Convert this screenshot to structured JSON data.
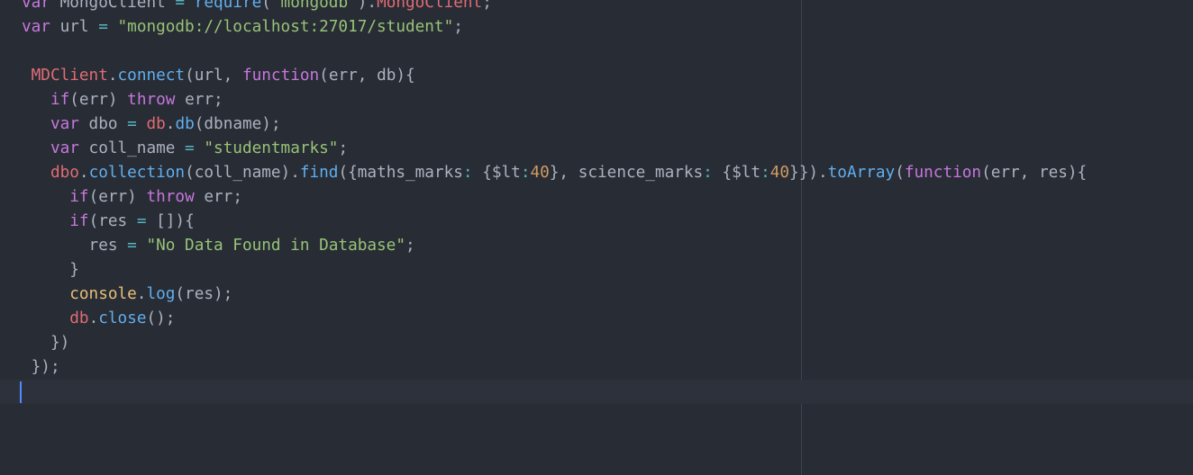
{
  "editor": {
    "language": "javascript",
    "theme_colors": {
      "background": "#282c34",
      "keyword": "#c678dd",
      "string": "#98c379",
      "number": "#d19a66",
      "function": "#61afef",
      "variable": "#e06c75",
      "support": "#e5c07b",
      "plain": "#abb2bf",
      "cursor": "#528bff"
    },
    "lines": [
      [
        {
          "t": "var",
          "c": "kw"
        },
        {
          "t": " MongoClient ",
          "c": "pl"
        },
        {
          "t": "=",
          "c": "op"
        },
        {
          "t": " ",
          "c": "pl"
        },
        {
          "t": "require",
          "c": "fn"
        },
        {
          "t": "(",
          "c": "pl"
        },
        {
          "t": "'mongodb'",
          "c": "str"
        },
        {
          "t": ").",
          "c": "pl"
        },
        {
          "t": "MongoClient",
          "c": "var"
        },
        {
          "t": ";",
          "c": "pl"
        }
      ],
      [
        {
          "t": "var",
          "c": "kw"
        },
        {
          "t": " url ",
          "c": "pl"
        },
        {
          "t": "=",
          "c": "op"
        },
        {
          "t": " ",
          "c": "pl"
        },
        {
          "t": "\"mongodb://localhost:27017/student\"",
          "c": "str"
        },
        {
          "t": ";",
          "c": "pl"
        }
      ],
      [],
      [
        {
          "t": " ",
          "c": "pl"
        },
        {
          "t": "MDClient",
          "c": "var"
        },
        {
          "t": ".",
          "c": "pl"
        },
        {
          "t": "connect",
          "c": "fn"
        },
        {
          "t": "(url, ",
          "c": "pl"
        },
        {
          "t": "function",
          "c": "kw"
        },
        {
          "t": "(err, db){",
          "c": "pl"
        }
      ],
      [
        {
          "t": "   ",
          "c": "pl"
        },
        {
          "t": "if",
          "c": "kw"
        },
        {
          "t": "(err) ",
          "c": "pl"
        },
        {
          "t": "throw",
          "c": "kw"
        },
        {
          "t": " err;",
          "c": "pl"
        }
      ],
      [
        {
          "t": "   ",
          "c": "pl"
        },
        {
          "t": "var",
          "c": "kw"
        },
        {
          "t": " dbo ",
          "c": "pl"
        },
        {
          "t": "=",
          "c": "op"
        },
        {
          "t": " ",
          "c": "pl"
        },
        {
          "t": "db",
          "c": "var"
        },
        {
          "t": ".",
          "c": "pl"
        },
        {
          "t": "db",
          "c": "fn"
        },
        {
          "t": "(dbname);",
          "c": "pl"
        }
      ],
      [
        {
          "t": "   ",
          "c": "pl"
        },
        {
          "t": "var",
          "c": "kw"
        },
        {
          "t": " coll_name ",
          "c": "pl"
        },
        {
          "t": "=",
          "c": "op"
        },
        {
          "t": " ",
          "c": "pl"
        },
        {
          "t": "\"studentmarks\"",
          "c": "str"
        },
        {
          "t": ";",
          "c": "pl"
        }
      ],
      [
        {
          "t": "   ",
          "c": "pl"
        },
        {
          "t": "dbo",
          "c": "var"
        },
        {
          "t": ".",
          "c": "pl"
        },
        {
          "t": "collection",
          "c": "fn"
        },
        {
          "t": "(coll_name).",
          "c": "pl"
        },
        {
          "t": "find",
          "c": "fn"
        },
        {
          "t": "({maths_marks",
          "c": "pl"
        },
        {
          "t": ":",
          "c": "op"
        },
        {
          "t": " {$lt",
          "c": "pl"
        },
        {
          "t": ":",
          "c": "op"
        },
        {
          "t": "40",
          "c": "num"
        },
        {
          "t": "}, science_marks",
          "c": "pl"
        },
        {
          "t": ":",
          "c": "op"
        },
        {
          "t": " {$lt",
          "c": "pl"
        },
        {
          "t": ":",
          "c": "op"
        },
        {
          "t": "40",
          "c": "num"
        },
        {
          "t": "}}).",
          "c": "pl"
        },
        {
          "t": "toArray",
          "c": "fn"
        },
        {
          "t": "(",
          "c": "pl"
        },
        {
          "t": "function",
          "c": "kw"
        },
        {
          "t": "(err, res){",
          "c": "pl"
        }
      ],
      [
        {
          "t": "     ",
          "c": "pl"
        },
        {
          "t": "if",
          "c": "kw"
        },
        {
          "t": "(err) ",
          "c": "pl"
        },
        {
          "t": "throw",
          "c": "kw"
        },
        {
          "t": " err;",
          "c": "pl"
        }
      ],
      [
        {
          "t": "     ",
          "c": "pl"
        },
        {
          "t": "if",
          "c": "kw"
        },
        {
          "t": "(res ",
          "c": "pl"
        },
        {
          "t": "=",
          "c": "op"
        },
        {
          "t": " []){",
          "c": "pl"
        }
      ],
      [
        {
          "t": "       res ",
          "c": "pl"
        },
        {
          "t": "=",
          "c": "op"
        },
        {
          "t": " ",
          "c": "pl"
        },
        {
          "t": "\"No Data Found in Database\"",
          "c": "str"
        },
        {
          "t": ";",
          "c": "pl"
        }
      ],
      [
        {
          "t": "     }",
          "c": "pl"
        }
      ],
      [
        {
          "t": "     ",
          "c": "pl"
        },
        {
          "t": "console",
          "c": "sup"
        },
        {
          "t": ".",
          "c": "pl"
        },
        {
          "t": "log",
          "c": "fn"
        },
        {
          "t": "(res);",
          "c": "pl"
        }
      ],
      [
        {
          "t": "     ",
          "c": "pl"
        },
        {
          "t": "db",
          "c": "var"
        },
        {
          "t": ".",
          "c": "pl"
        },
        {
          "t": "close",
          "c": "fn"
        },
        {
          "t": "();",
          "c": "pl"
        }
      ],
      [
        {
          "t": "   })",
          "c": "pl"
        }
      ],
      [
        {
          "t": " });",
          "c": "pl"
        }
      ],
      []
    ]
  }
}
